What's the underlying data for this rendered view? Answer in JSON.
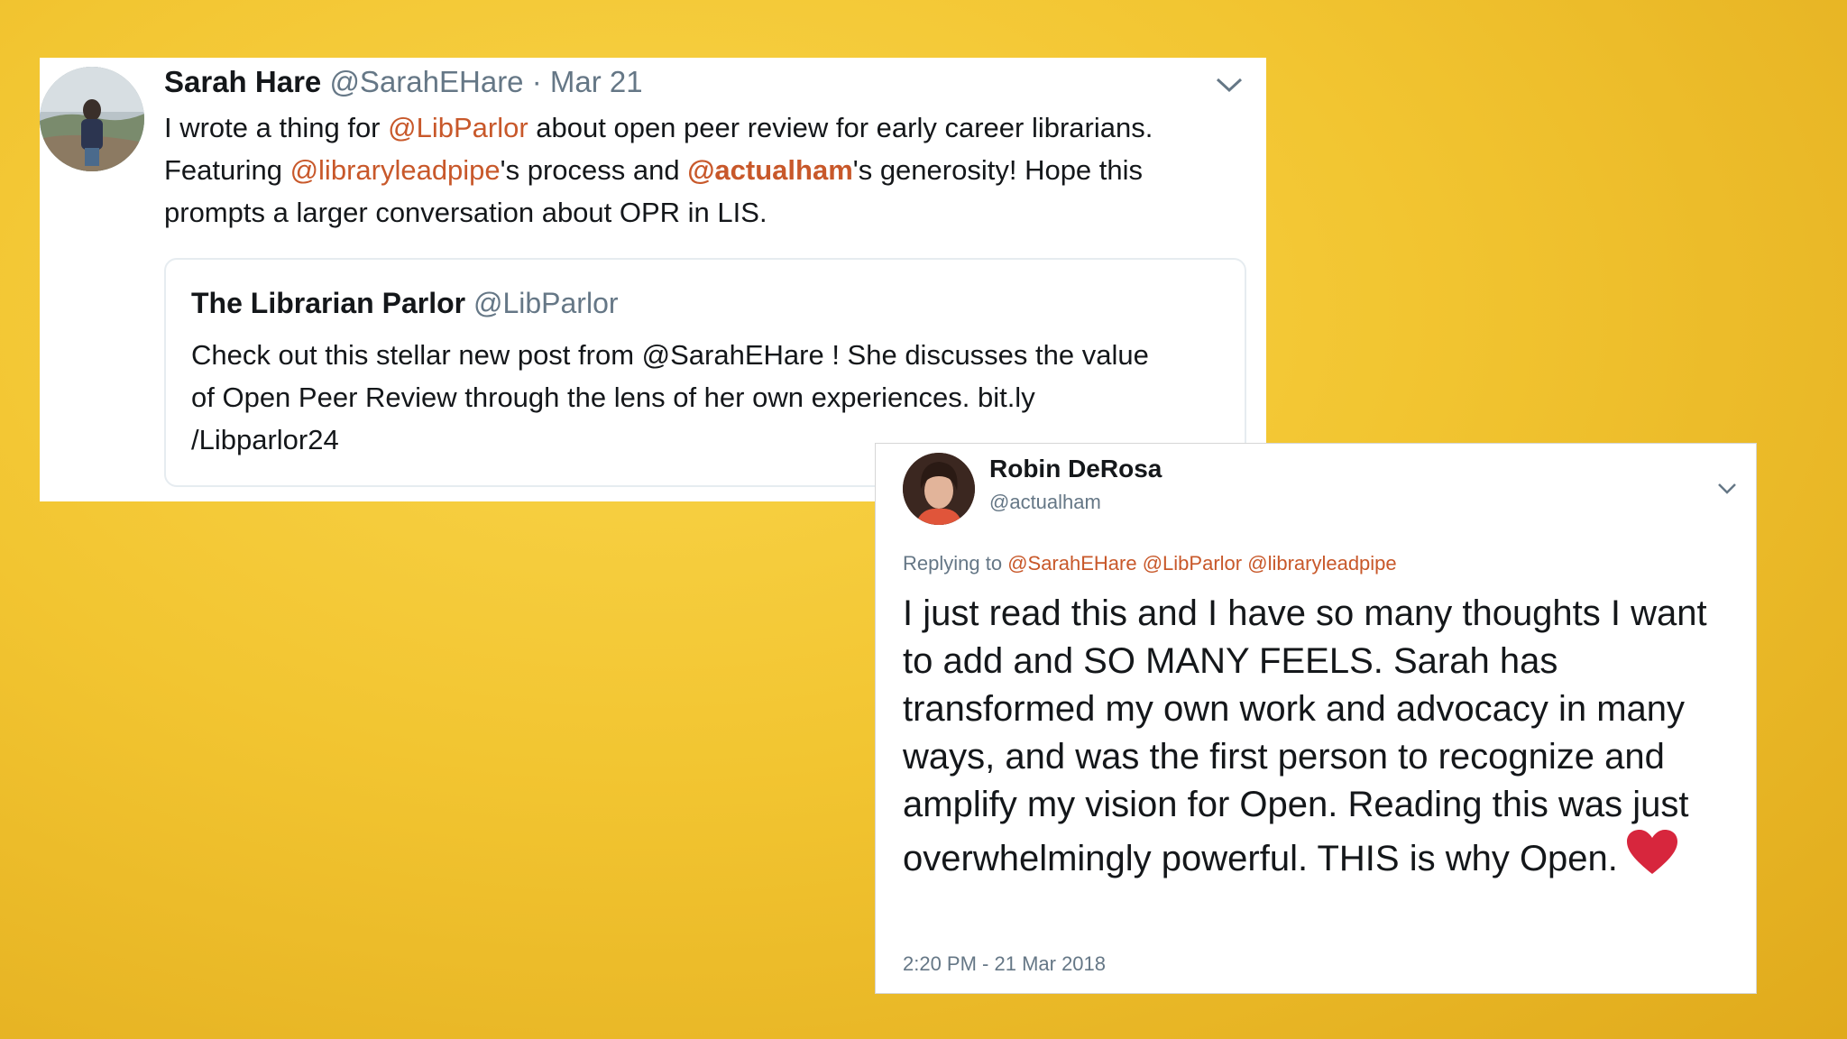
{
  "tweet1": {
    "name": "Sarah Hare",
    "handle": "@SarahEHare",
    "separator": "·",
    "date": "Mar 21",
    "body": {
      "t1": "I wrote a thing for ",
      "m1": "@LibParlor",
      "t2": " about open peer review for early career librarians. Featuring ",
      "m2": "@libraryleadpipe",
      "t3": "'s process and ",
      "m3": "@actualham",
      "t4": "'s generosity! Hope this prompts a larger conversation about OPR in LIS."
    },
    "quote": {
      "name": "The Librarian Parlor",
      "handle": "@LibParlor",
      "line1": "Check out this stellar new post from @SarahEHare ! She discusses the value",
      "line2": "of Open Peer Review through the lens of her own experiences. bit.ly",
      "line3": "/Libparlor24"
    }
  },
  "tweet2": {
    "name": "Robin DeRosa",
    "handle": "@actualham",
    "replying_label": "Replying to ",
    "replying_to": [
      "@SarahEHare",
      "@LibParlor",
      "@libraryleadpipe"
    ],
    "body": "I just read this and I have so many thoughts I want to add and SO MANY FEELS. Sarah has transformed my own work and advocacy in many ways, and was the first person to recognize and amplify my vision for Open. Reading this was just overwhelmingly powerful. THIS is why Open.",
    "timestamp": "2:20 PM - 21 Mar 2018"
  },
  "icons": {
    "menu_icon": "chevron-down-icon",
    "emoji": "red-heart-icon"
  },
  "colors": {
    "background": "#f2c531",
    "mention": "#c8582a",
    "muted": "#657786",
    "heart": "#d7263d"
  }
}
